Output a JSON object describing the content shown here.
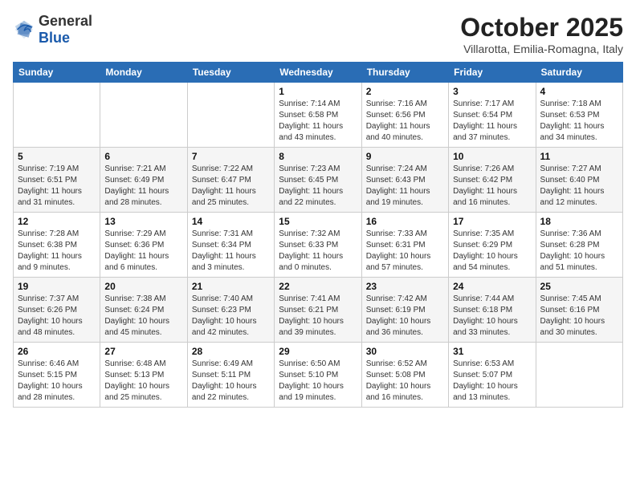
{
  "header": {
    "logo": {
      "general": "General",
      "blue": "Blue"
    },
    "title": "October 2025",
    "location": "Villarotta, Emilia-Romagna, Italy"
  },
  "calendar": {
    "days_of_week": [
      "Sunday",
      "Monday",
      "Tuesday",
      "Wednesday",
      "Thursday",
      "Friday",
      "Saturday"
    ],
    "weeks": [
      [
        {
          "day": "",
          "info": ""
        },
        {
          "day": "",
          "info": ""
        },
        {
          "day": "",
          "info": ""
        },
        {
          "day": "1",
          "info": "Sunrise: 7:14 AM\nSunset: 6:58 PM\nDaylight: 11 hours and 43 minutes."
        },
        {
          "day": "2",
          "info": "Sunrise: 7:16 AM\nSunset: 6:56 PM\nDaylight: 11 hours and 40 minutes."
        },
        {
          "day": "3",
          "info": "Sunrise: 7:17 AM\nSunset: 6:54 PM\nDaylight: 11 hours and 37 minutes."
        },
        {
          "day": "4",
          "info": "Sunrise: 7:18 AM\nSunset: 6:53 PM\nDaylight: 11 hours and 34 minutes."
        }
      ],
      [
        {
          "day": "5",
          "info": "Sunrise: 7:19 AM\nSunset: 6:51 PM\nDaylight: 11 hours and 31 minutes."
        },
        {
          "day": "6",
          "info": "Sunrise: 7:21 AM\nSunset: 6:49 PM\nDaylight: 11 hours and 28 minutes."
        },
        {
          "day": "7",
          "info": "Sunrise: 7:22 AM\nSunset: 6:47 PM\nDaylight: 11 hours and 25 minutes."
        },
        {
          "day": "8",
          "info": "Sunrise: 7:23 AM\nSunset: 6:45 PM\nDaylight: 11 hours and 22 minutes."
        },
        {
          "day": "9",
          "info": "Sunrise: 7:24 AM\nSunset: 6:43 PM\nDaylight: 11 hours and 19 minutes."
        },
        {
          "day": "10",
          "info": "Sunrise: 7:26 AM\nSunset: 6:42 PM\nDaylight: 11 hours and 16 minutes."
        },
        {
          "day": "11",
          "info": "Sunrise: 7:27 AM\nSunset: 6:40 PM\nDaylight: 11 hours and 12 minutes."
        }
      ],
      [
        {
          "day": "12",
          "info": "Sunrise: 7:28 AM\nSunset: 6:38 PM\nDaylight: 11 hours and 9 minutes."
        },
        {
          "day": "13",
          "info": "Sunrise: 7:29 AM\nSunset: 6:36 PM\nDaylight: 11 hours and 6 minutes."
        },
        {
          "day": "14",
          "info": "Sunrise: 7:31 AM\nSunset: 6:34 PM\nDaylight: 11 hours and 3 minutes."
        },
        {
          "day": "15",
          "info": "Sunrise: 7:32 AM\nSunset: 6:33 PM\nDaylight: 11 hours and 0 minutes."
        },
        {
          "day": "16",
          "info": "Sunrise: 7:33 AM\nSunset: 6:31 PM\nDaylight: 10 hours and 57 minutes."
        },
        {
          "day": "17",
          "info": "Sunrise: 7:35 AM\nSunset: 6:29 PM\nDaylight: 10 hours and 54 minutes."
        },
        {
          "day": "18",
          "info": "Sunrise: 7:36 AM\nSunset: 6:28 PM\nDaylight: 10 hours and 51 minutes."
        }
      ],
      [
        {
          "day": "19",
          "info": "Sunrise: 7:37 AM\nSunset: 6:26 PM\nDaylight: 10 hours and 48 minutes."
        },
        {
          "day": "20",
          "info": "Sunrise: 7:38 AM\nSunset: 6:24 PM\nDaylight: 10 hours and 45 minutes."
        },
        {
          "day": "21",
          "info": "Sunrise: 7:40 AM\nSunset: 6:23 PM\nDaylight: 10 hours and 42 minutes."
        },
        {
          "day": "22",
          "info": "Sunrise: 7:41 AM\nSunset: 6:21 PM\nDaylight: 10 hours and 39 minutes."
        },
        {
          "day": "23",
          "info": "Sunrise: 7:42 AM\nSunset: 6:19 PM\nDaylight: 10 hours and 36 minutes."
        },
        {
          "day": "24",
          "info": "Sunrise: 7:44 AM\nSunset: 6:18 PM\nDaylight: 10 hours and 33 minutes."
        },
        {
          "day": "25",
          "info": "Sunrise: 7:45 AM\nSunset: 6:16 PM\nDaylight: 10 hours and 30 minutes."
        }
      ],
      [
        {
          "day": "26",
          "info": "Sunrise: 6:46 AM\nSunset: 5:15 PM\nDaylight: 10 hours and 28 minutes."
        },
        {
          "day": "27",
          "info": "Sunrise: 6:48 AM\nSunset: 5:13 PM\nDaylight: 10 hours and 25 minutes."
        },
        {
          "day": "28",
          "info": "Sunrise: 6:49 AM\nSunset: 5:11 PM\nDaylight: 10 hours and 22 minutes."
        },
        {
          "day": "29",
          "info": "Sunrise: 6:50 AM\nSunset: 5:10 PM\nDaylight: 10 hours and 19 minutes."
        },
        {
          "day": "30",
          "info": "Sunrise: 6:52 AM\nSunset: 5:08 PM\nDaylight: 10 hours and 16 minutes."
        },
        {
          "day": "31",
          "info": "Sunrise: 6:53 AM\nSunset: 5:07 PM\nDaylight: 10 hours and 13 minutes."
        },
        {
          "day": "",
          "info": ""
        }
      ]
    ]
  }
}
